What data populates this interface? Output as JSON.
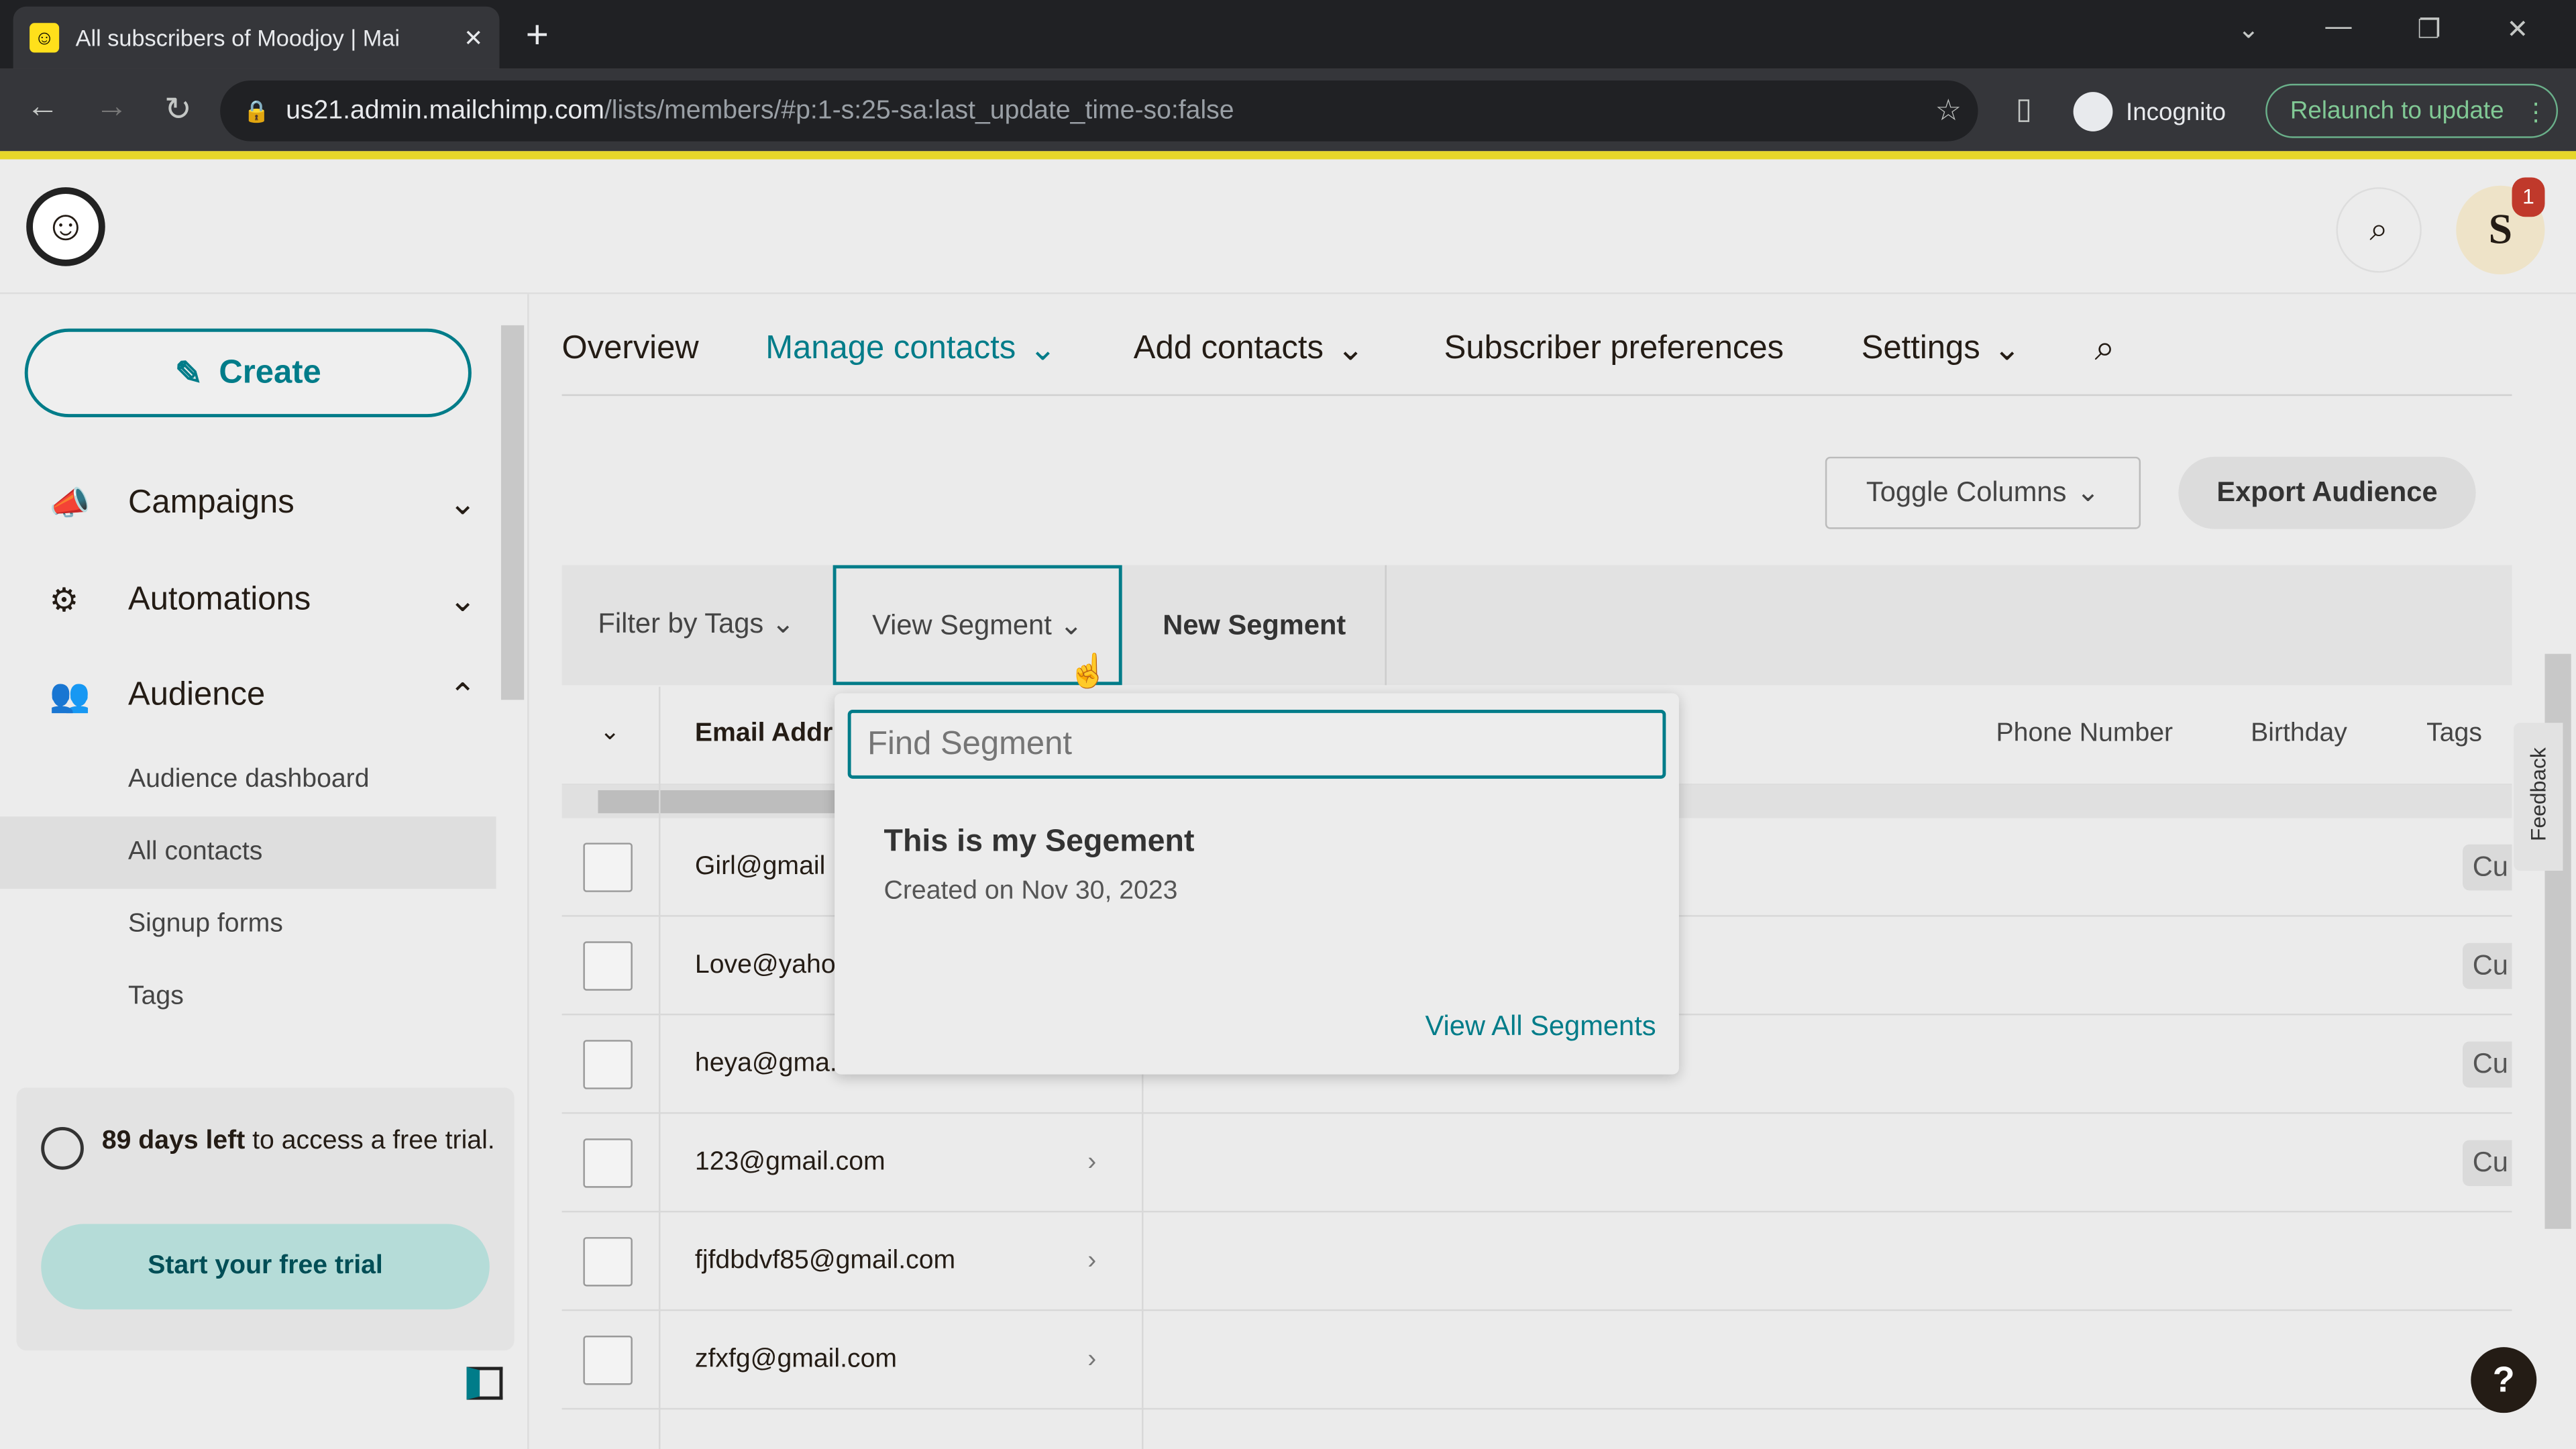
{
  "browser": {
    "tab_title": "All subscribers of Moodjoy | Mai",
    "url_domain": "us21.admin.mailchimp.com",
    "url_path": "/lists/members/#p:1-s:25-sa:last_update_time-so:false",
    "incognito_label": "Incognito",
    "relaunch_label": "Relaunch to update"
  },
  "header": {
    "avatar_letter": "S",
    "notification_count": "1"
  },
  "sidebar": {
    "create_label": "Create",
    "items": [
      {
        "label": "Campaigns"
      },
      {
        "label": "Automations"
      },
      {
        "label": "Audience"
      }
    ],
    "audience_sub": [
      "Audience dashboard",
      "All contacts",
      "Signup forms",
      "Tags"
    ],
    "trial_bold": "89 days left",
    "trial_text": " to access a free trial.",
    "trial_button": "Start your free trial"
  },
  "topnav": {
    "items": [
      "Overview",
      "Manage contacts",
      "Add contacts",
      "Subscriber preferences",
      "Settings"
    ]
  },
  "actions": {
    "toggle_columns": "Toggle Columns",
    "export": "Export Audience"
  },
  "filters": {
    "filter_by_tags": "Filter by Tags",
    "view_segment": "View Segment",
    "new_segment": "New Segment"
  },
  "table": {
    "columns": [
      "Email Addr",
      "Phone Number",
      "Birthday",
      "Tags"
    ],
    "rows": [
      {
        "email": "Girl@gmail",
        "tag": "Cu"
      },
      {
        "email": "Love@yaho",
        "tag": "Cu"
      },
      {
        "email": "heya@gma.",
        "tag": "Cu"
      },
      {
        "email": "123@gmail.com",
        "tag": "Cu"
      },
      {
        "email": "fjfdbdvf85@gmail.com",
        "tag": ""
      },
      {
        "email": "zfxfg@gmail.com",
        "tag": ""
      }
    ]
  },
  "segment_dropdown": {
    "placeholder": "Find Segment",
    "segment_name": "This is my Segement",
    "segment_created": "Created on Nov 30, 2023",
    "view_all": "View All Segments"
  },
  "feedback_label": "Feedback",
  "help_label": "?",
  "colors": {
    "accent": "#007c89",
    "brand_yellow": "#ffe01b"
  }
}
